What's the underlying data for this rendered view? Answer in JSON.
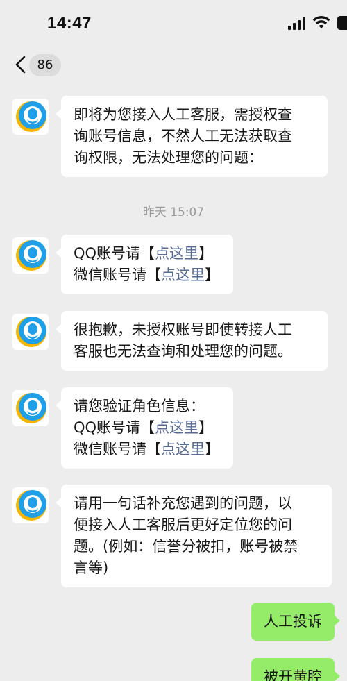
{
  "status_bar": {
    "time": "14:47"
  },
  "nav": {
    "unread_count": "86"
  },
  "messages": [
    {
      "lines": [
        "即将为您接入人工客服，需授权查",
        "询账号信息，不然人工无法获取查",
        "询权限，无法处理您的问题："
      ]
    },
    {
      "timestamp": "昨天 15:07"
    },
    {
      "lines": [
        {
          "prefix": "QQ账号请【",
          "link": "点这里",
          "suffix": "】"
        },
        {
          "prefix": "微信账号请【",
          "link": "点这里",
          "suffix": "】"
        }
      ]
    },
    {
      "lines": [
        "很抱歉，未授权账号即使转接人工",
        "客服也无法查询和处理您的问题。"
      ]
    },
    {
      "lines": [
        "请您验证角色信息：",
        {
          "prefix": "QQ账号请【",
          "link": "点这里",
          "suffix": "】"
        },
        {
          "prefix": "微信账号请【",
          "link": "点这里",
          "suffix": "】"
        }
      ]
    },
    {
      "lines": [
        "请用一句话补充您遇到的问题，以",
        "便接入人工客服后更好定位您的问",
        "题。(例如：信誉分被扣，账号被禁",
        "言等)"
      ]
    },
    {
      "outgoing_1": "人工投诉"
    },
    {
      "outgoing_2": "被开黄腔"
    }
  ],
  "colors": {
    "background": "#ededed",
    "bubble_in": "#ffffff",
    "bubble_out": "#95ec69",
    "link": "#576b95"
  },
  "icons": {
    "back": "chevron-left-icon",
    "bot_avatar": "qq-penguin-logo"
  }
}
